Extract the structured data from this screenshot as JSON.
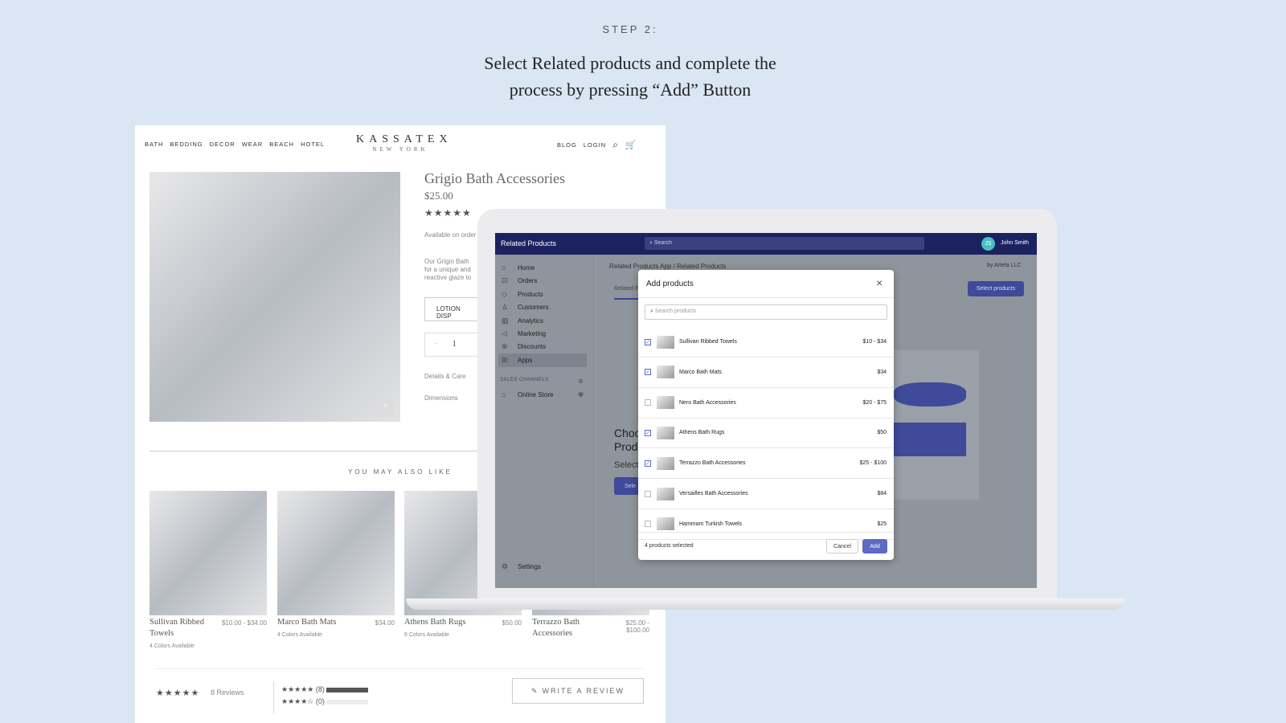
{
  "step": "STEP 2:",
  "headline": [
    "Select Related products and complete the",
    "process by pressing “Add” Button"
  ],
  "shop": {
    "nav_left": [
      "BATH",
      "BEDDING",
      "DECOR",
      "WEAR",
      "BEACH",
      "HOTEL"
    ],
    "logo": "KASSATEX",
    "logo_sub": "NEW YORK",
    "nav_right": [
      "BLOG",
      "LOGIN"
    ],
    "product_title": "Grigio Bath Accessories",
    "product_price": "$25.00",
    "rating_stars": "★★★★★",
    "availability": "Available on order",
    "description": [
      "Our Grigio Bath",
      "for a unique and",
      "reactive glaze to"
    ],
    "variant": "LOTION DISP",
    "quantity": "1",
    "qty_minus": "−",
    "accordion": [
      "Details & Care",
      "Dimensions"
    ],
    "also_like": "YOU MAY ALSO LIKE",
    "cards": [
      {
        "name": "Sullivan Ribbed Towels",
        "price": "$10.00 - $34.00",
        "colors": "4 Colors Available"
      },
      {
        "name": "Marco Bath Mats",
        "price": "$34.00",
        "colors": "4 Colors Available"
      },
      {
        "name": "Athens Bath Rugs",
        "price": "$50.00",
        "colors": "6 Colors Available"
      },
      {
        "name": "Terrazzo Bath Accessories",
        "price": "$25.00 - $100.00",
        "colors": ""
      }
    ],
    "reviews": {
      "stars": "★★★★★",
      "count": "8 Reviews",
      "bars": [
        {
          "stars": "★★★★★",
          "count": "(8)",
          "fill": 1
        },
        {
          "stars": "★★★★☆",
          "count": "(0)",
          "fill": 0
        }
      ],
      "write": "WRITE A REVIEW"
    }
  },
  "app": {
    "title": "Related Products",
    "search_placeholder": "Search",
    "avatar": "JS",
    "user": "John Smith",
    "sidebar": [
      {
        "icon": "⌂",
        "label": "Home"
      },
      {
        "icon": "⊡",
        "label": "Orders"
      },
      {
        "icon": "◇",
        "label": "Products"
      },
      {
        "icon": "♙",
        "label": "Customers"
      },
      {
        "icon": "▥",
        "label": "Analytics"
      },
      {
        "icon": "◁",
        "label": "Marketing"
      },
      {
        "icon": "⊛",
        "label": "Discounts"
      },
      {
        "icon": "⊞",
        "label": "Apps"
      }
    ],
    "sales_channels": "SALES CHANNELS",
    "online_store": "Online Store",
    "settings": "Settings",
    "breadcrumb": [
      "Related Products App",
      "Related Products"
    ],
    "by": "by Arteta LLC",
    "tab": "Related P",
    "select_products": "Select products",
    "bg_heading": [
      "Choo",
      "Produ"
    ],
    "bg_select": "Select",
    "bg_button": "Sele",
    "modal": {
      "title": "Add products",
      "search_placeholder": "Search products",
      "rows": [
        {
          "name": "Sullivan Ribbed Towels",
          "price": "$10 - $34",
          "checked": true
        },
        {
          "name": "Marco Bath Mats",
          "price": "$34",
          "checked": true
        },
        {
          "name": "Nero Bath Accessories",
          "price": "$20 - $75",
          "checked": false
        },
        {
          "name": "Athens Bath Rugs",
          "price": "$50",
          "checked": true
        },
        {
          "name": "Terrazzo Bath Accessories",
          "price": "$25 - $100",
          "checked": true
        },
        {
          "name": "Versailles Bath Accessories",
          "price": "$84",
          "checked": false
        },
        {
          "name": "Hammam Turkish Towels",
          "price": "$25",
          "checked": false
        }
      ],
      "selected": "4 products selected",
      "cancel": "Cancel",
      "add": "Add"
    },
    "colors": {
      "header": "#1c2260",
      "accent": "#5c6ac4"
    }
  }
}
